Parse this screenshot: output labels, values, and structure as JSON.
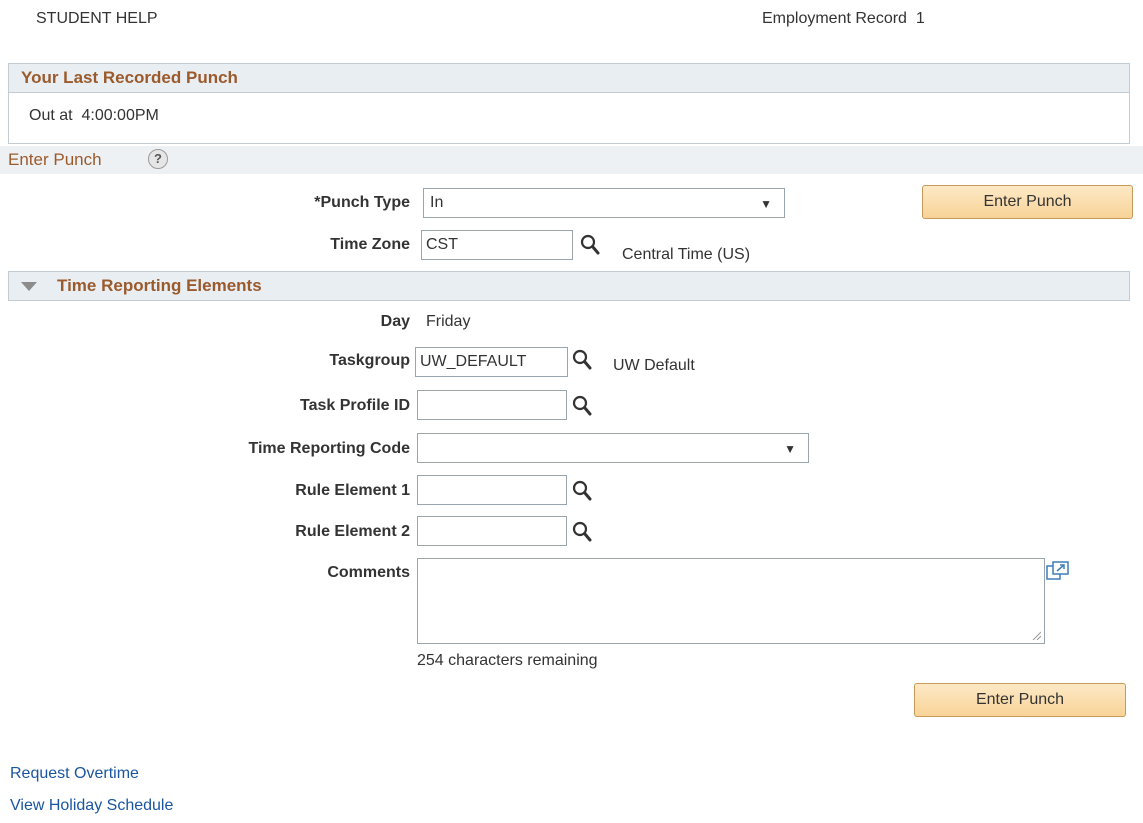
{
  "header": {
    "job_title": "STUDENT HELP",
    "employment_record_label": "Employment Record",
    "employment_record_number": "1"
  },
  "last_punch": {
    "title": "Your Last Recorded Punch",
    "text": "Out at  4:00:00PM"
  },
  "enter_punch": {
    "title": "Enter Punch",
    "help_icon_glyph": "?",
    "punch_type_label": "*Punch Type",
    "punch_type_value": "In",
    "time_zone_label": "Time Zone",
    "time_zone_value": "CST",
    "time_zone_desc": "Central Time (US)",
    "button_label": "Enter Punch"
  },
  "time_reporting": {
    "title": "Time Reporting Elements",
    "day_label": "Day",
    "day_value": "Friday",
    "taskgroup_label": "Taskgroup",
    "taskgroup_value": "UW_DEFAULT",
    "taskgroup_desc": "UW Default",
    "task_profile_label": "Task Profile ID",
    "task_profile_value": "",
    "trc_label": "Time Reporting Code",
    "trc_value": "",
    "rule1_label": "Rule Element 1",
    "rule1_value": "",
    "rule2_label": "Rule Element 2",
    "rule2_value": "",
    "comments_label": "Comments",
    "chars_remaining": "254 characters remaining",
    "button_label": "Enter Punch"
  },
  "links": {
    "request_overtime": "Request Overtime",
    "view_holiday_schedule": "View Holiday Schedule"
  },
  "icons": {
    "lookup": "magnifier-icon",
    "dropdown": "chevron-down-icon",
    "expand_comments": "expand-window-icon",
    "collapse": "triangle-down-icon"
  },
  "colors": {
    "section_title": "#9b5a2c",
    "link": "#1a56a0",
    "button_top": "#fde9c6",
    "button_bottom": "#f8d397"
  }
}
